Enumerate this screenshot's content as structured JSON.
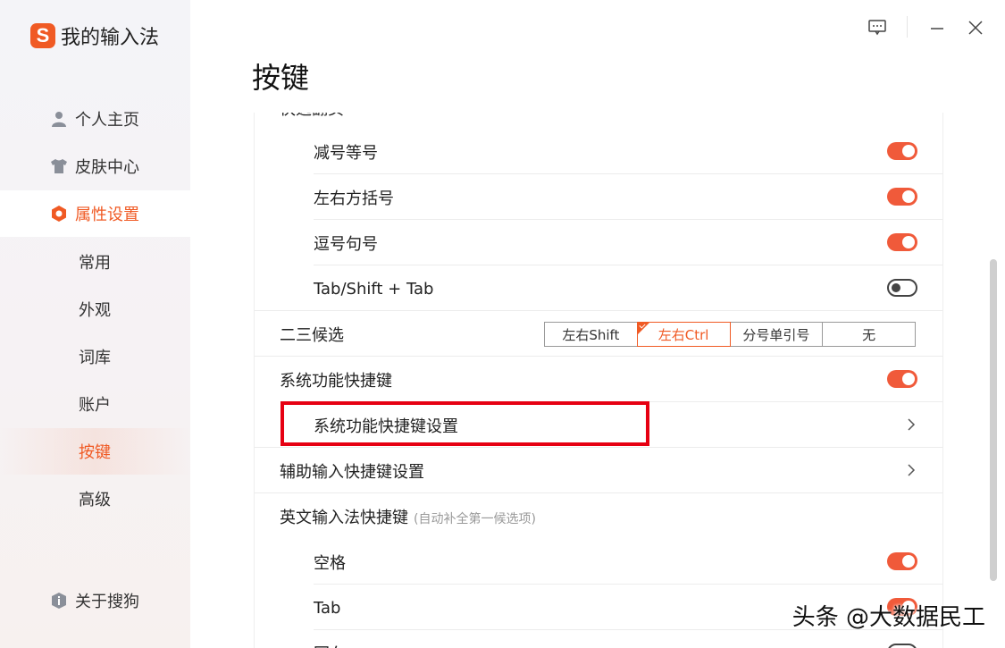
{
  "brand": {
    "logo_letter": "S",
    "name": "我的输入法"
  },
  "nav": [
    {
      "label": "个人主页",
      "icon": "user-icon"
    },
    {
      "label": "皮肤中心",
      "icon": "shirt-icon"
    },
    {
      "label": "属性设置",
      "icon": "hexagon-gear-icon",
      "active": true
    }
  ],
  "subnav": [
    {
      "label": "常用"
    },
    {
      "label": "外观"
    },
    {
      "label": "词库"
    },
    {
      "label": "账户"
    },
    {
      "label": "按键",
      "active": true
    },
    {
      "label": "高级"
    }
  ],
  "about": {
    "label": "关于搜狗",
    "icon": "info-shield-icon"
  },
  "window": {
    "feedback_icon": "feedback-icon",
    "minimize_icon": "minimize-icon",
    "close_icon": "close-icon"
  },
  "page_title": "按键",
  "rows": {
    "section_top_cut": "快选翻页",
    "minus_equal": {
      "label": "减号等号",
      "on": true
    },
    "brackets": {
      "label": "左右方括号",
      "on": true
    },
    "comma_period": {
      "label": "逗号句号",
      "on": true
    },
    "tab_shift_tab": {
      "label": "Tab/Shift + Tab",
      "on": false
    },
    "second_third": {
      "label": "二三候选",
      "options": [
        "左右Shift",
        "左右Ctrl",
        "分号单引号",
        "无"
      ],
      "selected": "左右Ctrl"
    },
    "system_shortcuts": {
      "label": "系统功能快捷键",
      "on": true
    },
    "system_shortcuts_settings": {
      "label": "系统功能快捷键设置"
    },
    "aux_input_settings": {
      "label": "辅助输入快捷键设置"
    },
    "english_shortcuts": {
      "label": "英文输入法快捷键",
      "hint": "(自动补全第一候选项)"
    },
    "space": {
      "label": "空格",
      "on": true
    },
    "tab": {
      "label": "Tab",
      "on": true
    },
    "bottom_cut": "回车"
  },
  "colors": {
    "accent": "#f05a24",
    "toggle_on": "#f05a3a",
    "highlight": "#e60012"
  },
  "watermark": "头条 @大数据民工"
}
